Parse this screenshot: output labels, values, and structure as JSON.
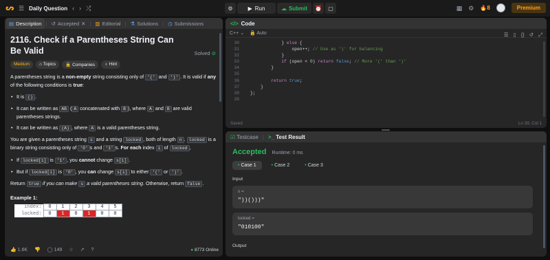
{
  "topbar": {
    "title": "Daily Question",
    "run": "Run",
    "submit": "Submit",
    "streak": "8",
    "premium": "Premium"
  },
  "left": {
    "tabs": [
      {
        "label": "Description",
        "icon": "document-icon"
      },
      {
        "label": "Accepted",
        "icon": "history-icon"
      },
      {
        "label": "Editorial",
        "icon": "book-icon"
      },
      {
        "label": "Solutions",
        "icon": "flask-icon"
      },
      {
        "label": "Submissions",
        "icon": "clock-icon"
      }
    ],
    "title": "2116. Check if a Parentheses String Can Be Valid",
    "solved": "Solved",
    "chips": [
      "Medium",
      "Topics",
      "Companies",
      "Hint"
    ],
    "example_title": "Example 1:",
    "table": {
      "label_index": "index:",
      "label_locked": "locked:",
      "index": [
        "0",
        "1",
        "2",
        "3",
        "4",
        "5"
      ],
      "locked": [
        "0",
        "1",
        "0",
        "1",
        "0",
        "0"
      ]
    },
    "likes": "1.6K",
    "comments": "149",
    "online": "8773 Online"
  },
  "code": {
    "header": "Code",
    "lang": "C++",
    "mode": "Auto",
    "lines": [
      {
        "n": "30",
        "c": "            } else {"
      },
      {
        "n": "31",
        "c": "                open++; // Use as ')' for balancing"
      },
      {
        "n": "32",
        "c": "            }"
      },
      {
        "n": "33",
        "c": "            if (open < 0) return false; // More '(' than ')'"
      },
      {
        "n": "34",
        "c": "        }"
      },
      {
        "n": "35",
        "c": ""
      },
      {
        "n": "36",
        "c": "        return true;"
      },
      {
        "n": "37",
        "c": "    }"
      },
      {
        "n": "38",
        "c": "};"
      },
      {
        "n": "39",
        "c": ""
      }
    ],
    "status": "Saved",
    "position": "Ln 39, Col 1"
  },
  "result": {
    "tab_testcase": "Testcase",
    "tab_result": "Test Result",
    "status": "Accepted",
    "runtime": "Runtime: 0 ms",
    "cases": [
      "Case 1",
      "Case 2",
      "Case 3"
    ],
    "input_label": "Input",
    "s_label": "s =",
    "s_value": "\"))()))\"",
    "locked_label": "locked =",
    "locked_value": "\"010100\"",
    "output_label": "Output"
  },
  "colors": {
    "accent": "#ffa116",
    "success": "#2cbb5d",
    "error": "#dc2626"
  }
}
